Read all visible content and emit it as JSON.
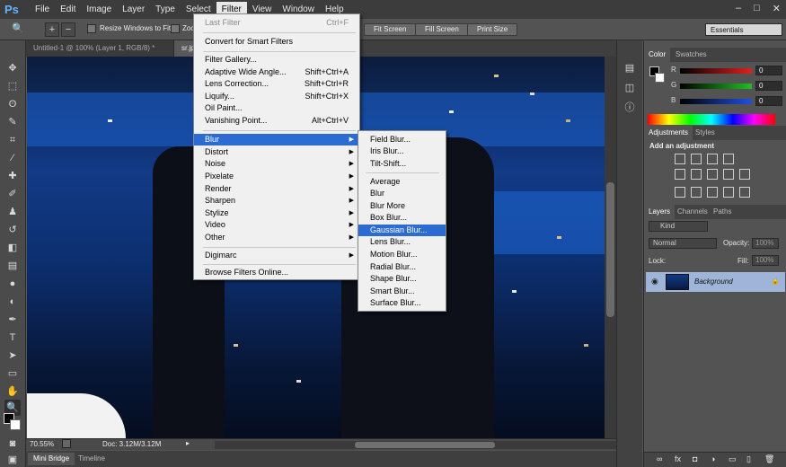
{
  "app": {
    "logo": "Ps"
  },
  "menubar": {
    "items": [
      "File",
      "Edit",
      "Image",
      "Layer",
      "Type",
      "Select",
      "Filter",
      "View",
      "Window",
      "Help"
    ],
    "active": "Filter",
    "window_controls": [
      "–",
      "□",
      "✕"
    ]
  },
  "options": {
    "resize_windows_label": "Resize Windows to Fit",
    "zoom_label": "Zoo",
    "fit_screen": "Fit Screen",
    "fill_screen": "Fill Screen",
    "print_size": "Print Size",
    "workspace": "Essentials"
  },
  "tabs": {
    "doc1": "Untitled-1 @ 100% (Layer 1, RGB/8) *",
    "doc2": "sr.jpg"
  },
  "filter_menu": {
    "items": [
      {
        "label": "Last Filter",
        "shortcut": "Ctrl+F",
        "disabled": true
      },
      {
        "label": "Convert for Smart Filters"
      },
      {
        "label": "Filter Gallery..."
      },
      {
        "label": "Adaptive Wide Angle...",
        "shortcut": "Shift+Ctrl+A"
      },
      {
        "label": "Lens Correction...",
        "shortcut": "Shift+Ctrl+R"
      },
      {
        "label": "Liquify...",
        "shortcut": "Shift+Ctrl+X"
      },
      {
        "label": "Oil Paint..."
      },
      {
        "label": "Vanishing Point...",
        "shortcut": "Alt+Ctrl+V"
      },
      {
        "label": "Blur",
        "submenu": true,
        "highlighted": true
      },
      {
        "label": "Distort",
        "submenu": true
      },
      {
        "label": "Noise",
        "submenu": true
      },
      {
        "label": "Pixelate",
        "submenu": true
      },
      {
        "label": "Render",
        "submenu": true
      },
      {
        "label": "Sharpen",
        "submenu": true
      },
      {
        "label": "Stylize",
        "submenu": true
      },
      {
        "label": "Video",
        "submenu": true
      },
      {
        "label": "Other",
        "submenu": true
      },
      {
        "label": "Digimarc",
        "submenu": true
      },
      {
        "label": "Browse Filters Online..."
      }
    ]
  },
  "blur_menu": {
    "items": [
      {
        "label": "Field Blur..."
      },
      {
        "label": "Iris Blur..."
      },
      {
        "label": "Tilt-Shift..."
      },
      {
        "label": "Average"
      },
      {
        "label": "Blur"
      },
      {
        "label": "Blur More"
      },
      {
        "label": "Box Blur..."
      },
      {
        "label": "Gaussian Blur...",
        "highlighted": true
      },
      {
        "label": "Lens Blur..."
      },
      {
        "label": "Motion Blur..."
      },
      {
        "label": "Radial Blur..."
      },
      {
        "label": "Shape Blur..."
      },
      {
        "label": "Smart Blur..."
      },
      {
        "label": "Surface Blur..."
      }
    ]
  },
  "status": {
    "zoom": "70.55%",
    "doc": "Doc: 3.12M/3.12M"
  },
  "bottom_tabs": [
    "Mini Bridge",
    "Timeline"
  ],
  "color_panel": {
    "tabs": [
      "Color",
      "Swatches"
    ],
    "channels": [
      {
        "label": "R",
        "value": "0",
        "color": "#e02020"
      },
      {
        "label": "G",
        "value": "0",
        "color": "#20c020"
      },
      {
        "label": "B",
        "value": "0",
        "color": "#2050e0"
      }
    ]
  },
  "adjustments_panel": {
    "tabs": [
      "Adjustments",
      "Styles"
    ],
    "heading": "Add an adjustment"
  },
  "layers_panel": {
    "tabs": [
      "Layers",
      "Channels",
      "Paths"
    ],
    "kind": "Kind",
    "blend_mode": "Normal",
    "opacity_label": "Opacity:",
    "opacity_value": "100%",
    "lock_label": "Lock:",
    "fill_label": "Fill:",
    "fill_value": "100%",
    "layer_name": "Background"
  }
}
